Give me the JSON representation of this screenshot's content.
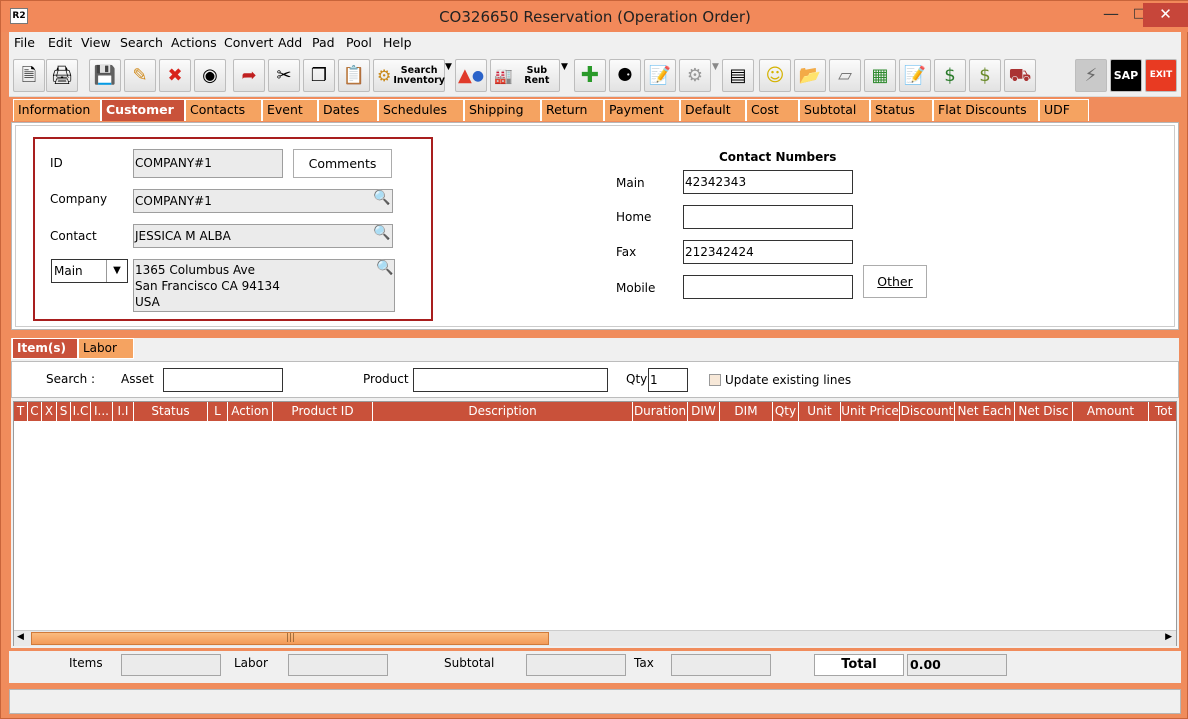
{
  "window": {
    "title": "CO326650 Reservation (Operation Order)",
    "app_icon_text": "R2"
  },
  "menu": [
    "File",
    "Edit",
    "View",
    "Search",
    "Actions",
    "Convert",
    "Add",
    "Pad",
    "Pool",
    "Help"
  ],
  "toolbar": {
    "search_inventory_label_1": "Search",
    "search_inventory_label_2": "Inventory",
    "sub_rent_label": "Sub Rent",
    "sap_label": "SAP",
    "exit_label": "EXIT"
  },
  "tabs": [
    "Information",
    "Customer",
    "Contacts",
    "Event",
    "Dates",
    "Schedules",
    "Shipping",
    "Return",
    "Payment",
    "Default",
    "Cost",
    "Subtotal",
    "Status",
    "Flat Discounts",
    "UDF"
  ],
  "customer": {
    "id_label": "ID",
    "id_value": "COMPANY#1",
    "comments_label": "Comments",
    "company_label": "Company",
    "company_value": "COMPANY#1",
    "contact_label": "Contact",
    "contact_value": "JESSICA M ALBA",
    "address_type": "Main",
    "address_line1": "1365 Columbus Ave",
    "address_line2": "San Francisco CA 94134",
    "address_line3": "USA"
  },
  "contact_numbers": {
    "header": "Contact Numbers",
    "main_label": "Main",
    "main_value": "42342343",
    "home_label": "Home",
    "home_value": "",
    "fax_label": "Fax",
    "fax_value": "212342424",
    "mobile_label": "Mobile",
    "mobile_value": "",
    "other_label": "Other"
  },
  "lower_tabs": [
    "Item(s)",
    "Labor"
  ],
  "search_row": {
    "search_label": "Search :",
    "asset_label": "Asset",
    "product_label": "Product",
    "qty_label": "Qty",
    "qty_value": "1",
    "update_label": "Update existing lines"
  },
  "grid_columns": [
    "T",
    "C",
    "X",
    "S",
    "I.C",
    "I...",
    "I.I",
    "Status",
    "L",
    "Action",
    "Product ID",
    "Description",
    "Duration",
    "DIW",
    "DIM",
    "Qty",
    "Unit",
    "Unit Price",
    "Discount",
    "Net Each",
    "Net Disc",
    "Amount",
    "Tot"
  ],
  "footer": {
    "items_label": "Items",
    "labor_label": "Labor",
    "subtotal_label": "Subtotal",
    "tax_label": "Tax",
    "total_label": "Total",
    "total_value": "0.00"
  },
  "colors": {
    "accent": "#f08c5c",
    "tab": "#f5a361",
    "active_tab": "#c9523a",
    "highlight_border": "#a81e1e"
  }
}
